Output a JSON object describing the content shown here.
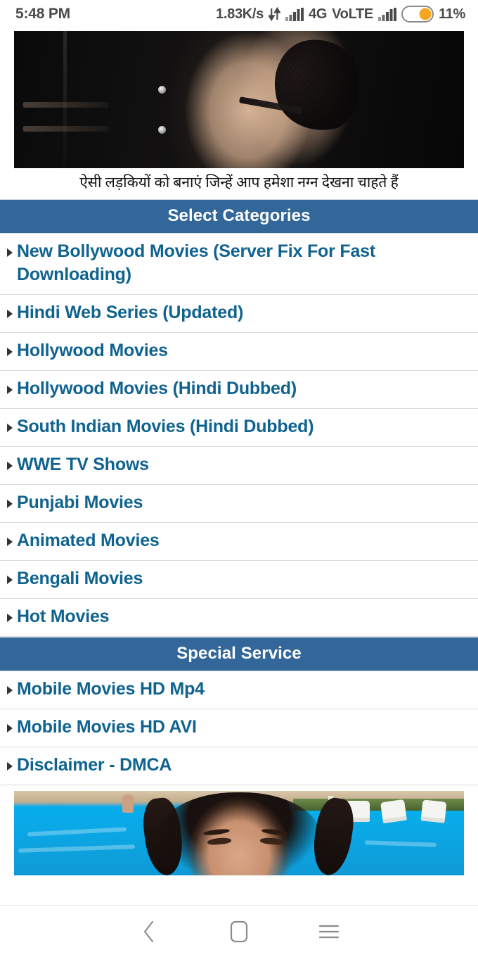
{
  "status_bar": {
    "time": "5:48 PM",
    "network_speed": "1.83K/s",
    "data_transfer_icon": "data-transfer-icon",
    "signal_icon_1": "signal-bars-icon",
    "network_type": "4G",
    "volte_label": "VoLTE",
    "signal_icon_2": "signal-bars-icon",
    "battery_icon": "battery-icon",
    "battery_percent": "11%",
    "text_color": "#4a4a4a",
    "battery_fill_color": "#f5a623"
  },
  "ad_top": {
    "name": "advertisement-banner-top",
    "caption": "ऐसी लड़कियों को बनाएं जिन्हें आप हमेशा नग्न देखना चाहते हैं"
  },
  "categories_section": {
    "header": "Select Categories",
    "header_bg": "#336699",
    "header_color": "#ffffff",
    "link_color": "#10638f",
    "items": [
      {
        "label": "New Bollywood Movies (Server Fix For Fast Downloading)"
      },
      {
        "label": "Hindi Web Series (Updated)"
      },
      {
        "label": "Hollywood Movies"
      },
      {
        "label": "Hollywood Movies (Hindi Dubbed)"
      },
      {
        "label": "South Indian Movies (Hindi Dubbed)"
      },
      {
        "label": "WWE TV Shows"
      },
      {
        "label": "Punjabi Movies"
      },
      {
        "label": "Animated Movies"
      },
      {
        "label": "Bengali Movies"
      },
      {
        "label": "Hot Movies"
      }
    ]
  },
  "special_section": {
    "header": "Special Service",
    "items": [
      {
        "label": "Mobile Movies HD Mp4"
      },
      {
        "label": "Mobile Movies HD AVI"
      },
      {
        "label": "Disclaimer - DMCA"
      }
    ]
  },
  "ad_bottom": {
    "name": "advertisement-banner-bottom"
  },
  "nav_bar": {
    "back": "back-icon",
    "home": "home-icon",
    "menu": "menu-icon"
  }
}
